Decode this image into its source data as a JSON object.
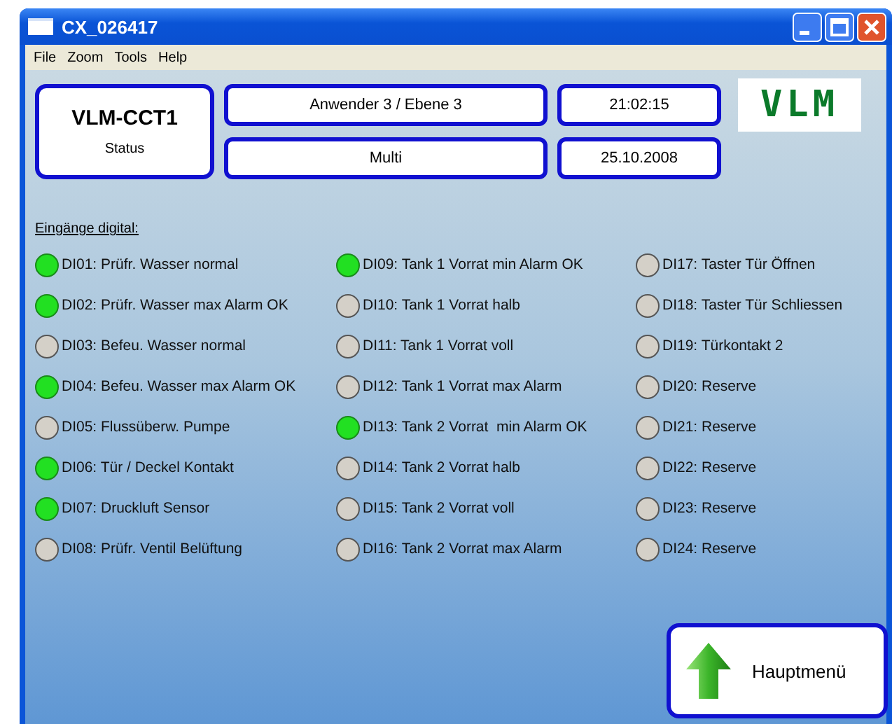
{
  "window": {
    "title": "CX_026417"
  },
  "menu": [
    "File",
    "Zoom",
    "Tools",
    "Help"
  ],
  "header": {
    "device": "VLM-CCT1",
    "device_label": "Status",
    "user": "Anwender 3 / Ebene 3",
    "mode": "Multi",
    "time": "21:02:15",
    "date": "25.10.2008",
    "logo": "VLM"
  },
  "inputs_title": "Eingänge digital:",
  "inputs": [
    [
      {
        "label": "DI01: Prüfr. Wasser normal",
        "on": true
      },
      {
        "label": "DI02: Prüfr. Wasser max Alarm OK",
        "on": true
      },
      {
        "label": "DI03: Befeu. Wasser normal",
        "on": false
      },
      {
        "label": "DI04: Befeu. Wasser max Alarm OK",
        "on": true
      },
      {
        "label": "DI05: Flussüberw. Pumpe",
        "on": false
      },
      {
        "label": "DI06: Tür / Deckel Kontakt",
        "on": true
      },
      {
        "label": "DI07: Druckluft Sensor",
        "on": true
      },
      {
        "label": "DI08: Prüfr. Ventil Belüftung",
        "on": false
      }
    ],
    [
      {
        "label": "DI09: Tank 1 Vorrat min Alarm OK",
        "on": true
      },
      {
        "label": "DI10: Tank 1 Vorrat halb",
        "on": false
      },
      {
        "label": "DI11: Tank 1 Vorrat voll",
        "on": false
      },
      {
        "label": "DI12: Tank 1 Vorrat max Alarm",
        "on": false
      },
      {
        "label": "DI13: Tank 2 Vorrat  min Alarm OK",
        "on": true
      },
      {
        "label": "DI14: Tank 2 Vorrat halb",
        "on": false
      },
      {
        "label": "DI15: Tank 2 Vorrat voll",
        "on": false
      },
      {
        "label": "DI16: Tank 2 Vorrat max Alarm",
        "on": false
      }
    ],
    [
      {
        "label": "DI17: Taster Tür Öffnen",
        "on": false
      },
      {
        "label": "DI18: Taster Tür Schliessen",
        "on": false
      },
      {
        "label": "DI19: Türkontakt 2",
        "on": false
      },
      {
        "label": "DI20: Reserve",
        "on": false
      },
      {
        "label": "DI21: Reserve",
        "on": false
      },
      {
        "label": "DI22: Reserve",
        "on": false
      },
      {
        "label": "DI23: Reserve",
        "on": false
      },
      {
        "label": "DI24: Reserve",
        "on": false
      }
    ]
  ],
  "main_menu_button": "Hauptmenü"
}
